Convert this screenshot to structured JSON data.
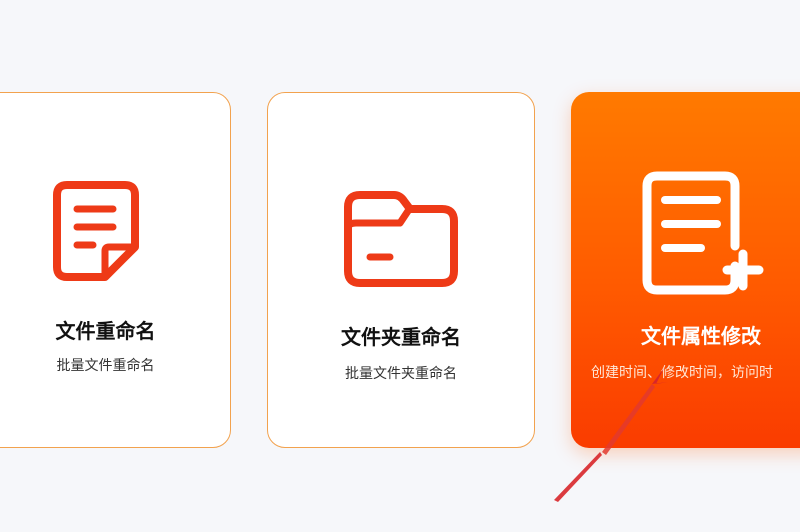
{
  "cards": [
    {
      "title": "文件重命名",
      "subtitle": "批量文件重命名",
      "icon": "document-icon",
      "accent": "#ee3a17"
    },
    {
      "title": "文件夹重命名",
      "subtitle": "批量文件夹重命名",
      "icon": "folder-icon",
      "accent": "#ee3a17"
    },
    {
      "title": "文件属性修改",
      "subtitle": "创建时间、修改时间，访问时",
      "icon": "document-plus-icon",
      "accent": "#ffffff",
      "selected": true
    }
  ],
  "colors": {
    "background": "#f6f7fa",
    "card_border": "#f2a24e",
    "active_gradient_top": "#ff7a00",
    "active_gradient_bottom": "#fa3c00"
  }
}
